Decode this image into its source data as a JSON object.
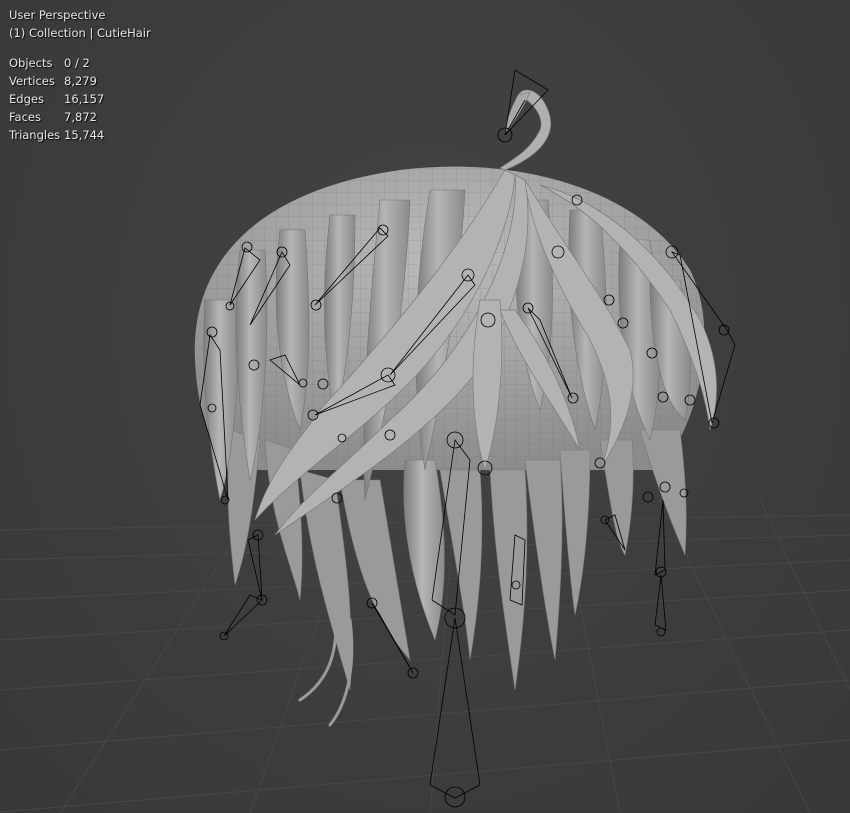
{
  "viewport": {
    "view_name": "User Perspective",
    "collection_line": "(1) Collection | CutieHair",
    "stats": [
      {
        "label": "Objects",
        "value": "0 / 2"
      },
      {
        "label": "Vertices",
        "value": "8,279"
      },
      {
        "label": "Edges",
        "value": "16,157"
      },
      {
        "label": "Faces",
        "value": "7,872"
      },
      {
        "label": "Triangles",
        "value": "15,744"
      }
    ]
  },
  "colors": {
    "background": "#3d3d3d",
    "grid": "#474747",
    "mesh": "#a3a3a3",
    "wire": "#000000"
  }
}
